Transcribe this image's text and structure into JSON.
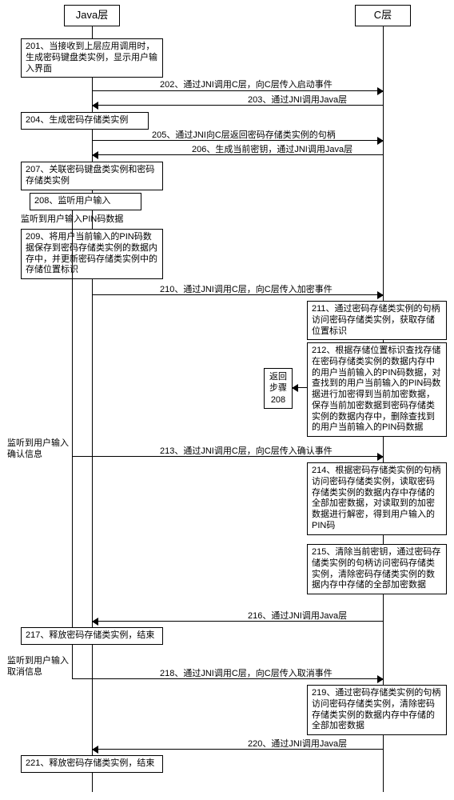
{
  "lifelines": {
    "java": "Java层",
    "c": "C层"
  },
  "boxes": {
    "b201": "201、当接收到上层应用调用时，生成密码键盘类实例，显示用户输入界面",
    "b204": "204、生成密码存储类实例",
    "b207": "207、关联密码键盘类实例和密码存储类实例",
    "b208": "208、监听用户输入",
    "b209": "209、将用户当前输入的PIN码数据保存到密码存储类实例的数据内存中，并更新密码存储类实例中的存储位置标识",
    "b211": "211、通过密码存储类实例的句柄访问密码存储类实例，获取存储位置标识",
    "b212": "212、根据存储位置标识查找存储在密码存储类实例的数据内存中的用户当前输入的PIN码数据，对查找到的用户当前输入的PIN码数据进行加密得到当前加密数据，保存当前加密数据到密码存储类实例的数据内存中，删除查找到的用户当前输入的PIN码数据",
    "b214": "214、根据密码存储类实例的句柄访问密码存储类实例，读取密码存储类实例的数据内存中存储的全部加密数据，对读取到的加密数据进行解密，得到用户输入的PIN码",
    "b215": "215、清除当前密钥，通过密码存储类实例的句柄访问密码存储类实例，清除密码存储类实例的数据内存中存储的全部加密数据",
    "b217": "217、释放密码存储类实例，结束",
    "b219": "219、通过密码存储类实例的句柄访问密码存储类实例，清除密码存储类实例的数据内存中存储的全部加密数据",
    "b221": "221、释放密码存储类实例，结束"
  },
  "messages": {
    "m202": "202、通过JNI调用C层，向C层传入启动事件",
    "m203": "203、通过JNI调用Java层",
    "m205": "205、通过JNI向C层返回密码存储类实例的句柄",
    "m206": "206、生成当前密钥，通过JNI调用Java层",
    "m210": "210、通过JNI调用C层，向C层传入加密事件",
    "m213": "213、通过JNI调用C层，向C层传入确认事件",
    "m216": "216、通过JNI调用Java层",
    "m218": "218、通过JNI调用C层，向C层传入取消事件",
    "m220": "220、通过JNI调用Java层"
  },
  "notes": {
    "n1": "监听到用户输入PIN码数据",
    "n2": "监听到用户输入确认信息",
    "n3": "监听到用户输入取消信息",
    "ret": "返回步骤208"
  }
}
